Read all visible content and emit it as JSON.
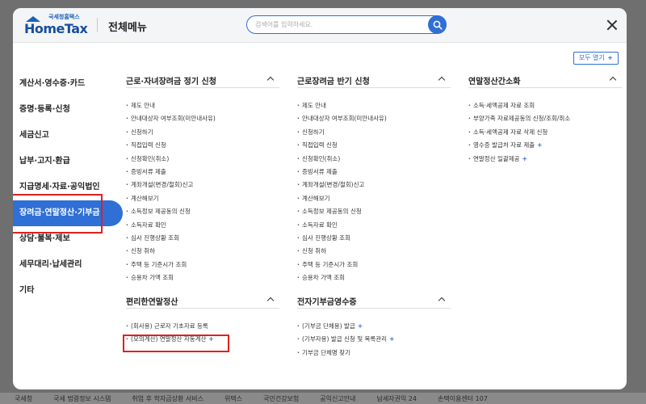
{
  "footer_items": [
    "국세청",
    "국세 법령정보 시스템",
    "취업 후 학자금상환 서비스",
    "위택스",
    "국민건강보험",
    "공익신고안내",
    "납세자권익 24",
    "손택이용센터 107"
  ],
  "header": {
    "logo_sub": "국세청홈택스",
    "logo_main": "HomeTax",
    "title": "전체메뉴",
    "search_placeholder": "검색어를 입력하세요."
  },
  "open_all_label": "모두 열기",
  "sidebar": [
    {
      "label": "계산서·영수증·카드",
      "active": false
    },
    {
      "label": "증명·등록·신청",
      "active": false
    },
    {
      "label": "세금신고",
      "active": false
    },
    {
      "label": "납부·고지·환급",
      "active": false
    },
    {
      "label": "지급명세·자료·공익법인",
      "active": false
    },
    {
      "label": "장려금·연말정산·기부금",
      "active": true
    },
    {
      "label": "상담·불복·제보",
      "active": false
    },
    {
      "label": "세무대리·납세관리",
      "active": false
    },
    {
      "label": "기타",
      "active": false
    }
  ],
  "sections": [
    {
      "title": "근로·자녀장려금 정기 신청",
      "items": [
        "제도 안내",
        "안내대상자 여부조회(미안내사유)",
        "신청하기",
        "직접입력 신청",
        "신청확인(취소)",
        "증빙서류 제출",
        "계좌개설(변경/철회)신고",
        "계산해보기",
        "소득정보 제공동의 신청",
        "소득자료 확인",
        "심사 진행상황 조회",
        "신청 취하",
        "주택 등 기준시가 조회",
        "승용차 가액 조회"
      ]
    },
    {
      "title": "근로장려금 반기 신청",
      "items": [
        "제도 안내",
        "안내대상자 여부조회(미안내사유)",
        "신청하기",
        "직접입력 신청",
        "신청확인(취소)",
        "증빙서류 제출",
        "계좌개설(변경/철회)신고",
        "계산해보기",
        "소득정보 제공동의 신청",
        "소득자료 확인",
        "심사 진행상황 조회",
        "신청 취하",
        "주택 등 기준시가 조회",
        "승용차 가액 조회"
      ]
    },
    {
      "title": "연말정산간소화",
      "items": [
        "소득·세액공제 자료 조회",
        "부양가족 자료제공동의 신청/조회/취소",
        "소득·세액공제 자료 삭제 신청",
        "영수증 발급처 자료 제출",
        "연말정산 일괄제공"
      ]
    },
    {
      "title": "편리한연말정산",
      "items": [
        "(회사용) 근로자 기초자료 등록",
        "(모의계산) 연말정산 자동계산"
      ]
    },
    {
      "title": "전자기부금영수증",
      "items": [
        "(기부금 단체용) 발급",
        "(기부자용) 발급 신청 및 목록관리",
        "기부금 단체명 찾기"
      ]
    }
  ],
  "plus_sign": "+"
}
